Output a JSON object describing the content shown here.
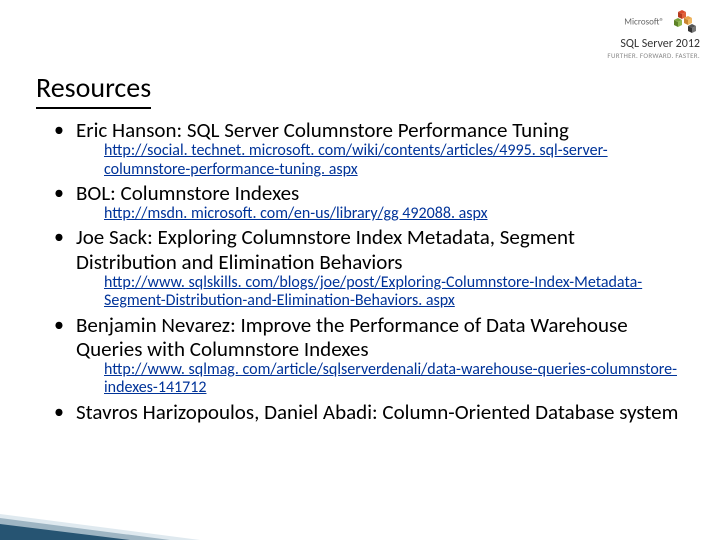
{
  "brand": {
    "prefix": "Microsoft®",
    "name": "SQL Server 2012",
    "tagline": "FURTHER. FORWARD. FASTER."
  },
  "title": "Resources",
  "items": [
    {
      "title": "Eric Hanson: SQL Server Columnstore Performance Tuning",
      "link": "http://social. technet. microsoft. com/wiki/contents/articles/4995. sql-server-columnstore-performance-tuning. aspx"
    },
    {
      "title": "BOL: Columnstore Indexes",
      "link": "http://msdn. microsoft. com/en-us/library/gg 492088. aspx"
    },
    {
      "title": "Joe Sack: Exploring Columnstore Index Metadata, Segment Distribution and Elimination Behaviors",
      "link": "http://www. sqlskills. com/blogs/joe/post/Exploring-Columnstore-Index-Metadata-Segment-Distribution-and-Elimination-Behaviors. aspx"
    },
    {
      "title": "Benjamin Nevarez: Improve the Performance of Data Warehouse Queries with Columnstore Indexes",
      "link": "http://www. sqlmag. com/article/sqlserverdenali/data-warehouse-queries-columnstore-indexes-141712"
    },
    {
      "title": "Stavros Harizopoulos, Daniel Abadi: Column-Oriented Database system",
      "link": ""
    }
  ]
}
